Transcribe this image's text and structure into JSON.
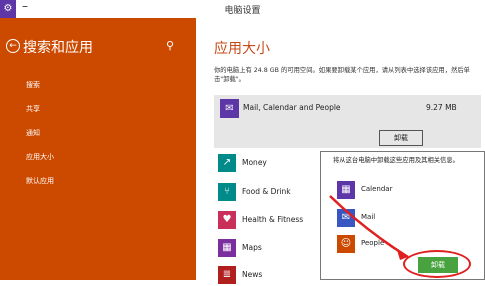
{
  "window": {
    "title": "电脑设置",
    "minimize": "–"
  },
  "sidebar": {
    "title": "搜索和应用",
    "items": [
      {
        "label": "搜索"
      },
      {
        "label": "共享"
      },
      {
        "label": "通知"
      },
      {
        "label": "应用大小"
      },
      {
        "label": "默认应用"
      }
    ]
  },
  "main": {
    "title": "应用大小",
    "description": "你的电脑上有 24.8 GB 的可用空间。如果要卸载某个应用，请从列表中选择该应用，然后单击\"卸载\"。",
    "selected_app": {
      "name": "Mail, Calendar and People",
      "size": "9.27 MB",
      "uninstall_label": "卸载"
    },
    "apps": [
      {
        "name": "Money",
        "icon": "chart-icon"
      },
      {
        "name": "Food & Drink",
        "icon": "fork-knife-icon"
      },
      {
        "name": "Health & Fitness",
        "icon": "heart-icon"
      },
      {
        "name": "Maps",
        "icon": "map-icon"
      },
      {
        "name": "News",
        "icon": "newspaper-icon"
      }
    ]
  },
  "flyout": {
    "message": "将从这台电脑中卸载这些应用及其相关信息。",
    "items": [
      {
        "name": "Calendar",
        "icon": "calendar-icon"
      },
      {
        "name": "Mail",
        "icon": "mail-icon"
      },
      {
        "name": "People",
        "icon": "people-icon"
      }
    ],
    "uninstall_label": "卸载"
  },
  "colors": {
    "sidebar_bg": "#cc4a00",
    "accent_title": "#c64b18",
    "app_tile": "#008a8a",
    "people_tile": "#cc4a00",
    "mail_tile": "#3a56c2",
    "uninstall_green": "#48a23f",
    "highlight_red": "#e02020"
  }
}
